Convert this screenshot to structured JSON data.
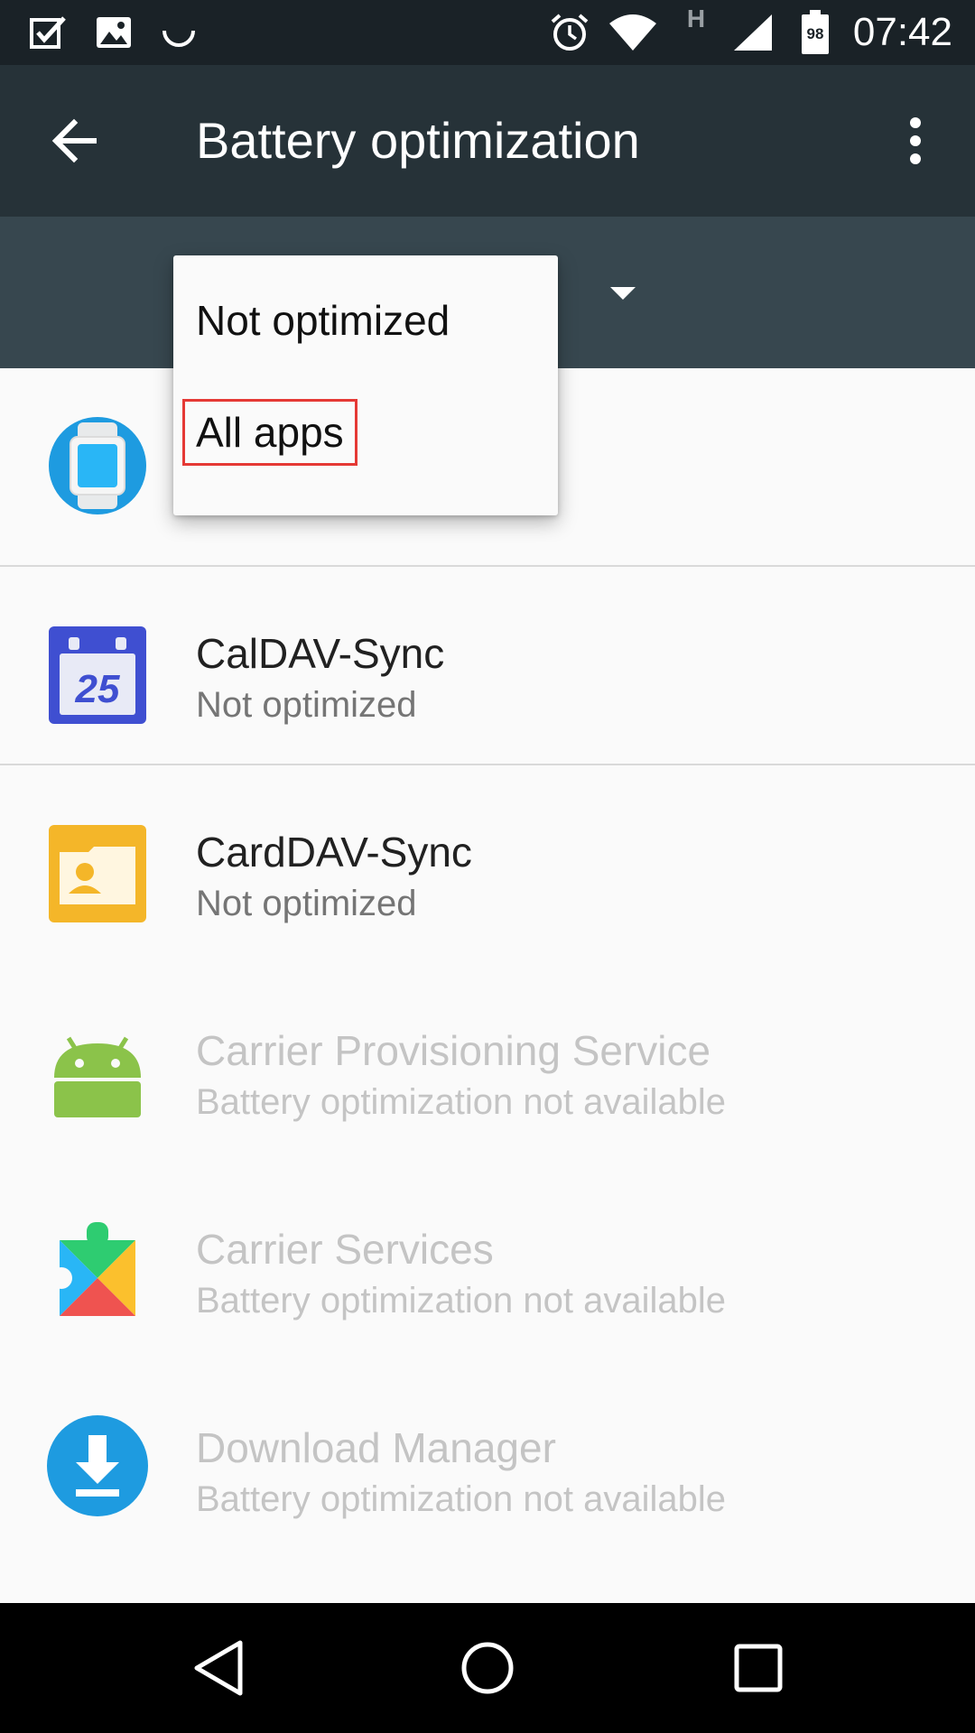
{
  "status_bar": {
    "time": "07:42",
    "battery_level": "98",
    "network_label": "H",
    "left_icons": [
      "tasks-icon",
      "image-icon",
      "sync-icon"
    ],
    "right_icons": [
      "alarm-icon",
      "wifi-icon",
      "network-type-icon",
      "signal-icon",
      "battery-icon"
    ]
  },
  "app_bar": {
    "title": "Battery optimization",
    "back_icon": "arrow-back-icon",
    "overflow_icon": "more-vert-icon"
  },
  "filter": {
    "options": [
      "Not optimized",
      "All apps"
    ],
    "highlighted_option": "All apps"
  },
  "apps": [
    {
      "name": "",
      "status": "",
      "icon": "android-wear-icon",
      "enabled": true
    },
    {
      "name": "CalDAV-Sync",
      "status": "Not optimized",
      "icon": "calendar-icon",
      "icon_text": "25",
      "enabled": true
    },
    {
      "name": "CardDAV-Sync",
      "status": "Not optimized",
      "icon": "contacts-folder-icon",
      "enabled": true
    },
    {
      "name": "Carrier Provisioning Service",
      "status": "Battery optimization not available",
      "icon": "android-robot-icon",
      "enabled": false
    },
    {
      "name": "Carrier Services",
      "status": "Battery optimization not available",
      "icon": "carrier-services-icon",
      "enabled": false
    },
    {
      "name": "Download Manager",
      "status": "Battery optimization not available",
      "icon": "download-icon",
      "enabled": false
    }
  ],
  "nav_bar": {
    "buttons": [
      "back-nav-icon",
      "home-nav-icon",
      "recents-nav-icon"
    ]
  },
  "colors": {
    "status_bar": "#1a2227",
    "app_bar": "#263238",
    "filter_bar": "#37474f",
    "highlight_box": "#e53935"
  }
}
